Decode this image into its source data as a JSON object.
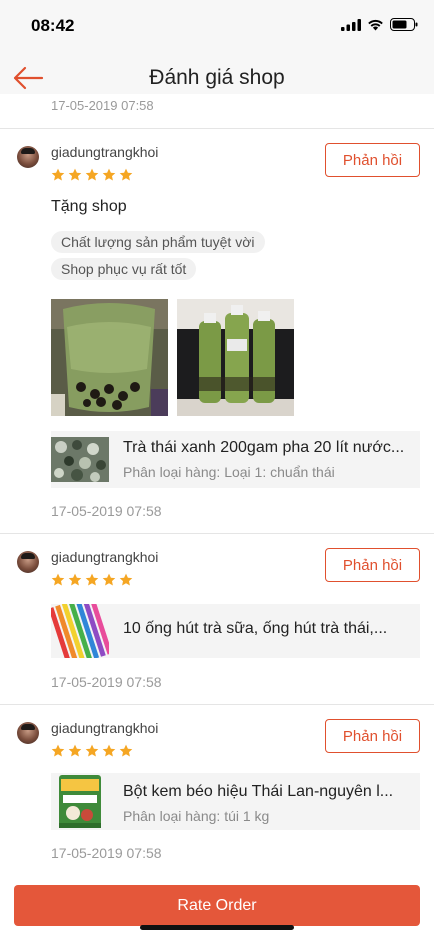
{
  "status": {
    "time": "08:42"
  },
  "header": {
    "title": "Đánh giá shop",
    "back_icon": "arrow-left-icon"
  },
  "top_date": "17-05-2019 07:58",
  "reviews": [
    {
      "username": "giadungtrangkhoi",
      "rating": 5,
      "reply_label": "Phản hồi",
      "text": "Tặng shop",
      "tags": [
        "Chất lượng sản phẩm tuyệt vời",
        "Shop phục vụ rất tốt"
      ],
      "product": {
        "name": "Trà thái xanh 200gam pha 20 lít nước...",
        "variant": "Phân loại hàng: Loại 1: chuẩn thái"
      },
      "date": "17-05-2019 07:58"
    },
    {
      "username": "giadungtrangkhoi",
      "rating": 5,
      "reply_label": "Phản hồi",
      "product": {
        "name": "10 ống hút trà sữa, ống hút trà thái,..."
      },
      "date": "17-05-2019 07:58"
    },
    {
      "username": "giadungtrangkhoi",
      "rating": 5,
      "reply_label": "Phản hồi",
      "product": {
        "name": "Bột kem béo hiệu Thái Lan-nguyên l...",
        "variant": "Phân loại hàng: túi 1 kg"
      },
      "date": "17-05-2019 07:58"
    }
  ],
  "footer": {
    "rate_label": "Rate Order"
  },
  "colors": {
    "accent": "#e0502e",
    "button": "#e4573a",
    "star": "#f5a623"
  }
}
